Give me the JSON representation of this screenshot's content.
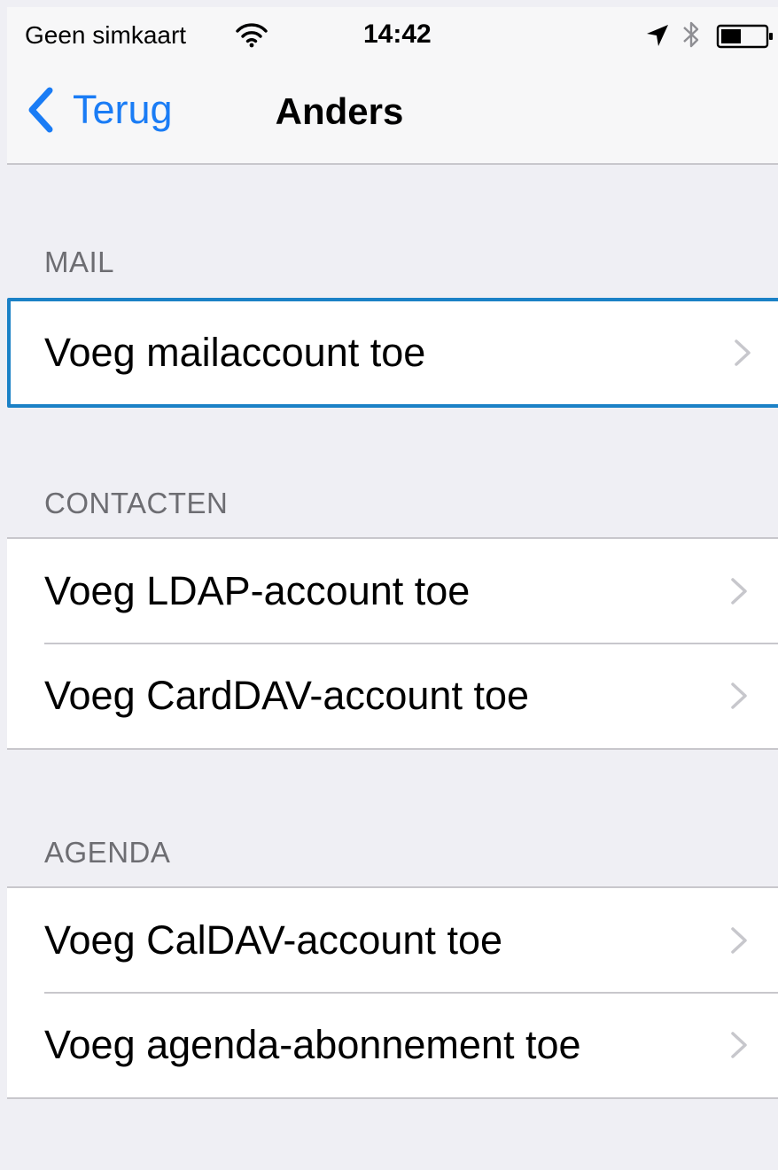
{
  "status_bar": {
    "carrier": "Geen simkaart",
    "time": "14:42",
    "icons": [
      "wifi-icon",
      "location-arrow-icon",
      "bluetooth-icon",
      "battery-icon"
    ]
  },
  "nav": {
    "back_label": "Terug",
    "title": "Anders"
  },
  "sections": {
    "mail": {
      "header": "MAIL",
      "rows": [
        "Voeg mailaccount toe"
      ]
    },
    "contacten": {
      "header": "CONTACTEN",
      "rows": [
        "Voeg LDAP-account toe",
        "Voeg CardDAV-account toe"
      ]
    },
    "agenda": {
      "header": "AGENDA",
      "rows": [
        "Voeg CalDAV-account toe",
        "Voeg agenda-abonnement toe"
      ]
    }
  },
  "colors": {
    "accent": "#1a7cf5",
    "background": "#efeff4",
    "separator": "#c8c7cc",
    "section_header": "#6d6d72",
    "focus_ring": "#1b81c6"
  }
}
